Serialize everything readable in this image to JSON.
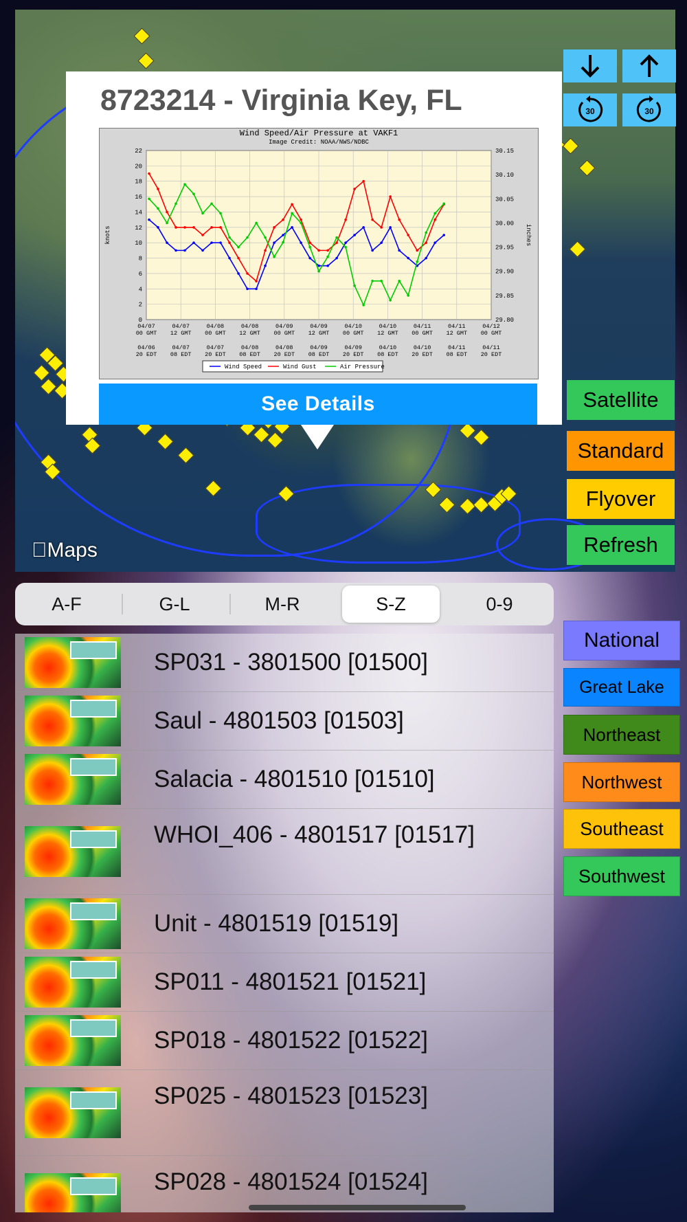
{
  "popup": {
    "title": "8723214 - Virginia Key, FL",
    "details_button": "See Details"
  },
  "chart_data": {
    "type": "line",
    "title": "Wind Speed/Air Pressure at VAKF1",
    "subtitle": "Image Credit: NOAA/NWS/NDBC",
    "ylabel": "knots",
    "y2label": "inches",
    "ylim": [
      0,
      22
    ],
    "y2lim": [
      29.8,
      30.15
    ],
    "y_ticks": [
      "22",
      "20",
      "18",
      "16",
      "14",
      "12",
      "10",
      "8",
      "6",
      "4",
      "2",
      "0"
    ],
    "y2_ticks": [
      "30.15",
      "30.10",
      "30.05",
      "30.00",
      "29.95",
      "29.90",
      "29.85",
      "29.80"
    ],
    "x_ticks_gmt": [
      [
        "04/07",
        "00 GMT"
      ],
      [
        "04/07",
        "12 GMT"
      ],
      [
        "04/08",
        "00 GMT"
      ],
      [
        "04/08",
        "12 GMT"
      ],
      [
        "04/09",
        "00 GMT"
      ],
      [
        "04/09",
        "12 GMT"
      ],
      [
        "04/10",
        "00 GMT"
      ],
      [
        "04/10",
        "12 GMT"
      ],
      [
        "04/11",
        "00 GMT"
      ],
      [
        "04/11",
        "12 GMT"
      ],
      [
        "04/12",
        "00 GMT"
      ]
    ],
    "x_ticks_edt": [
      [
        "04/06",
        "20 EDT"
      ],
      [
        "04/07",
        "08 EDT"
      ],
      [
        "04/07",
        "20 EDT"
      ],
      [
        "04/08",
        "08 EDT"
      ],
      [
        "04/08",
        "20 EDT"
      ],
      [
        "04/09",
        "08 EDT"
      ],
      [
        "04/09",
        "20 EDT"
      ],
      [
        "04/10",
        "08 EDT"
      ],
      [
        "04/10",
        "20 EDT"
      ],
      [
        "04/11",
        "08 EDT"
      ],
      [
        "04/11",
        "20 EDT"
      ]
    ],
    "grid": true,
    "legend_position": "bottom",
    "series": [
      {
        "name": "Wind Speed",
        "color": "#0000ff",
        "axis": "left",
        "values": [
          13,
          12,
          10,
          9,
          9,
          10,
          9,
          10,
          10,
          8,
          6,
          4,
          4,
          7,
          10,
          11,
          12,
          10,
          8,
          7,
          7,
          8,
          10,
          11,
          12,
          9,
          10,
          12,
          9,
          8,
          7,
          8,
          10,
          11
        ]
      },
      {
        "name": "Wind Gust",
        "color": "#ff0000",
        "axis": "left",
        "values": [
          19,
          17,
          14,
          12,
          12,
          12,
          11,
          12,
          12,
          10,
          8,
          6,
          5,
          9,
          12,
          13,
          15,
          13,
          10,
          9,
          9,
          10,
          13,
          17,
          18,
          13,
          12,
          16,
          13,
          11,
          9,
          10,
          13,
          15
        ]
      },
      {
        "name": "Air Pressure",
        "color": "#00cc00",
        "axis": "right",
        "values": [
          30.05,
          30.03,
          30.0,
          30.04,
          30.08,
          30.06,
          30.02,
          30.04,
          30.02,
          29.97,
          29.95,
          29.97,
          30.0,
          29.97,
          29.93,
          29.96,
          30.02,
          30.0,
          29.95,
          29.9,
          29.93,
          29.97,
          29.95,
          29.87,
          29.83,
          29.88,
          29.88,
          29.84,
          29.88,
          29.85,
          29.92,
          29.98,
          30.02,
          30.04
        ]
      }
    ]
  },
  "map": {
    "attribution": "Maps"
  },
  "map_controls": [
    {
      "name": "down-arrow-icon"
    },
    {
      "name": "up-arrow-icon"
    },
    {
      "name": "rewind-30-icon",
      "text": "30"
    },
    {
      "name": "forward-30-icon",
      "text": "30"
    }
  ],
  "map_types": [
    {
      "label": "Satellite",
      "color": "#34c759"
    },
    {
      "label": "Standard",
      "color": "#ff9500"
    },
    {
      "label": "Flyover",
      "color": "#ffcc00"
    },
    {
      "label": "Refresh",
      "color": "#34c759"
    }
  ],
  "segments": {
    "items": [
      "A-F",
      "G-L",
      "M-R",
      "S-Z",
      "0-9"
    ],
    "selected": "S-Z"
  },
  "stations": [
    {
      "label": "SP031 - 3801500 [01500]"
    },
    {
      "label": "Saul - 4801503 [01503]"
    },
    {
      "label": "Salacia - 4801510 [01510]"
    },
    {
      "label": "WHOI_406 - 4801517 [01517]"
    },
    {
      "label": "Unit - 4801519 [01519]"
    },
    {
      "label": "SP011 - 4801521 [01521]"
    },
    {
      "label": "SP018 - 4801522 [01522]"
    },
    {
      "label": "SP025 - 4801523 [01523]"
    },
    {
      "label": "SP028 - 4801524 [01524]"
    }
  ],
  "regions": [
    {
      "label": "National",
      "color": "#7a7aff"
    },
    {
      "label": "Great Lake",
      "color": "#0a84ff"
    },
    {
      "label": "Northeast",
      "color": "#3f8a1a"
    },
    {
      "label": "Northwest",
      "color": "#ff8c1a"
    },
    {
      "label": "Southeast",
      "color": "#ffc20a"
    },
    {
      "label": "Southwest",
      "color": "#34c759"
    }
  ]
}
